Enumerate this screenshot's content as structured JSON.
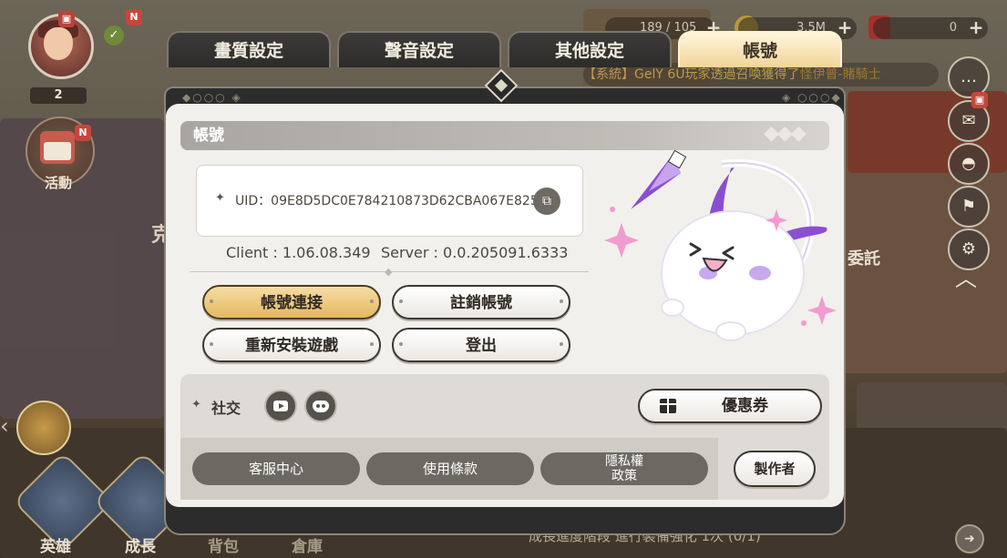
{
  "hud": {
    "level": "2",
    "avatar_badge_new": "N",
    "event_badge_new": "N",
    "event_label": "活動",
    "resources": [
      {
        "icon": "key-icon",
        "value": "189 / 105"
      },
      {
        "icon": "gold-coin-icon",
        "value": "3.5M"
      },
      {
        "icon": "gem-icon",
        "value": "0"
      }
    ],
    "marquee_prefix": "【系統】",
    "marquee_user": "GelY 6U",
    "marquee_text": "玩家透過召喚獲得了",
    "marquee_item": "怪伊普-賭騎士",
    "right_label": "委託",
    "left_label": "克",
    "bottom_nav": [
      {
        "label": "英雄"
      },
      {
        "label": "成長"
      },
      {
        "label": "背包"
      },
      {
        "label": "倉庫"
      }
    ],
    "quest_text": "成長進度階段 進行裝備強化 1次 (0/1)"
  },
  "tabs": [
    {
      "label": "畫質設定",
      "active": false
    },
    {
      "label": "聲音設定",
      "active": false
    },
    {
      "label": "其他設定",
      "active": false
    },
    {
      "label": "帳號",
      "active": true
    }
  ],
  "account": {
    "section_title": "帳號",
    "uid_label": "UID：09E8D5DC0E784210873D62CBA067E825",
    "client_version": "Client : 1.06.08.349",
    "server_version": "Server : 0.0.205091.6333",
    "buttons": {
      "link": "帳號連接",
      "delete": "註銷帳號",
      "reinstall": "重新安裝遊戲",
      "logout": "登出"
    },
    "social_label": "社交",
    "coupon_label": "優惠券",
    "support_label": "客服中心",
    "terms_label": "使用條款",
    "privacy_label_line1": "隱私權",
    "privacy_label_line2": "政策",
    "credits_label": "製作者"
  },
  "colors": {
    "active_tab": "#f1d597",
    "gold_button": "#e5b85e",
    "panel_bg": "#f2f0ec",
    "mascot_purple": "#8a4fd0"
  }
}
